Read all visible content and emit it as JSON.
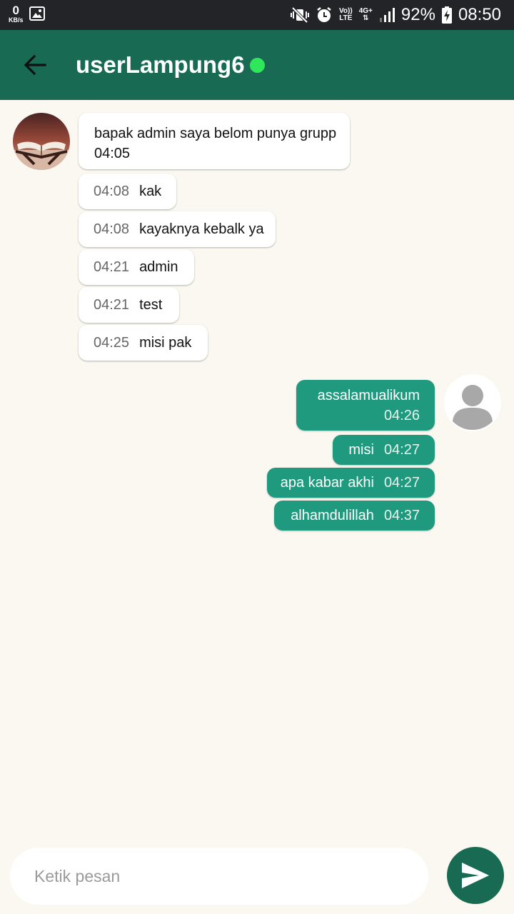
{
  "status_bar": {
    "net_speed_value": "0",
    "net_speed_unit": "KB/s",
    "volte_label_1": "Vo))",
    "volte_label_2": "LTE",
    "network_label_1": "4G+",
    "battery_percent": "92%",
    "time": "08:50"
  },
  "header": {
    "title": "userLampung6",
    "online_color": "#2ee85a",
    "bar_color": "#186b52"
  },
  "messages_in": [
    {
      "text": "bapak admin saya belom punya grupp",
      "time": "04:05"
    },
    {
      "text": "kak",
      "time": "04:08"
    },
    {
      "text": "kayaknya kebalk ya",
      "time": "04:08"
    },
    {
      "text": "admin",
      "time": "04:21"
    },
    {
      "text": "test",
      "time": "04:21"
    },
    {
      "text": "misi pak",
      "time": "04:25"
    }
  ],
  "messages_out": [
    {
      "text": "assalamualikum",
      "time": "04:26"
    },
    {
      "text": "misi",
      "time": "04:27"
    },
    {
      "text": "apa kabar akhi",
      "time": "04:27"
    },
    {
      "text": "alhamdulillah",
      "time": "04:37"
    }
  ],
  "composer": {
    "placeholder": "Ketik pesan"
  },
  "icons": {
    "back": "arrow-left-icon",
    "send": "send-icon",
    "default_avatar": "person-icon"
  }
}
